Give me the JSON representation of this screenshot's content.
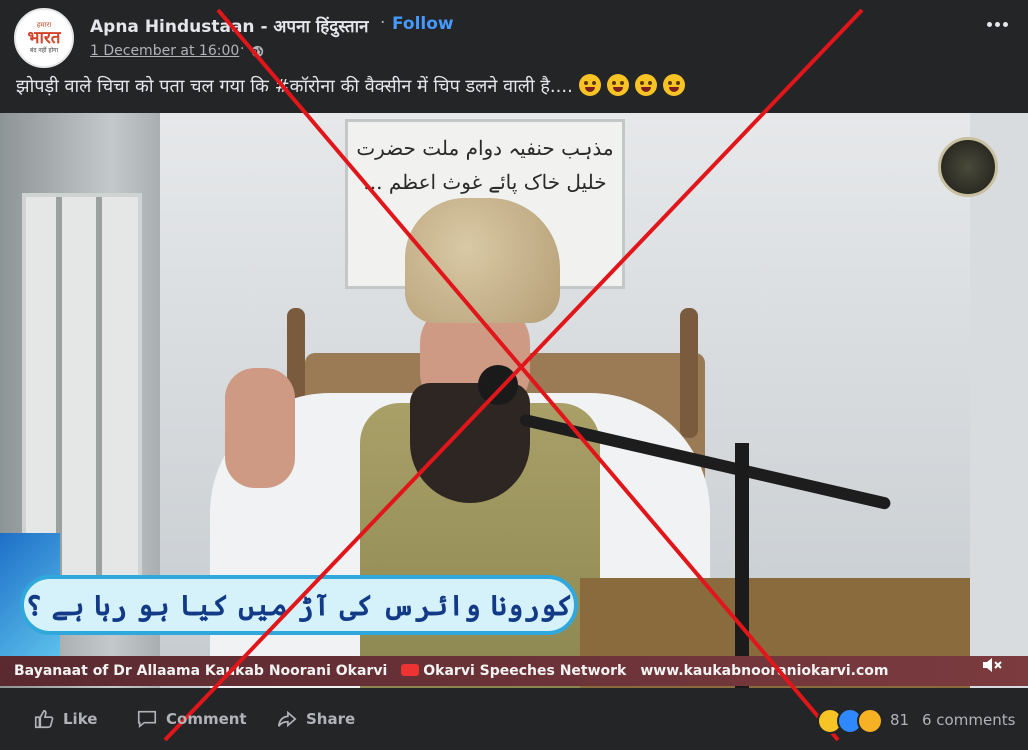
{
  "post": {
    "page_name": "Apna Hindustaan - अपना हिंदुस्तान",
    "follow_label": "Follow",
    "timestamp": "1 December at 16:00",
    "separator": "·",
    "caption": "झोपड़ी वाले चिचा को पता चल गया कि #कॉरोना की वैक्सीन में चिप डलने वाली है....",
    "avatar": {
      "line1": "हमारा",
      "line2": "भारत",
      "line3": "बंद नहीं होगा"
    }
  },
  "video": {
    "urdu_plaque": "مذہب حنفیہ دوام ملت حضرت خلیل خاک پائے غوث اعظم ...",
    "banner_text": "کورونا وائرس کی آڑ میں کیا ہو رہا ہے ؟",
    "ticker_1": "Bayanaat of Dr Allaama Kaukab Noorani Okarvi",
    "ticker_2": "Okarvi Speeches Network",
    "ticker_3": "www.kaukabnooraniokarvi.com"
  },
  "actions": {
    "like_label": "Like",
    "comment_label": "Comment",
    "share_label": "Share",
    "reaction_count": "81",
    "comments_count": "6 comments"
  },
  "icons": {
    "globe": "globe-icon",
    "more": "more-icon",
    "like": "like-icon",
    "comment": "comment-icon",
    "share": "share-icon",
    "mute": "mute-icon"
  },
  "colors": {
    "background": "#242526",
    "text": "#e4e6eb",
    "muted": "#b0b3b8",
    "link": "#4599ff",
    "cross": "#e0161b"
  }
}
